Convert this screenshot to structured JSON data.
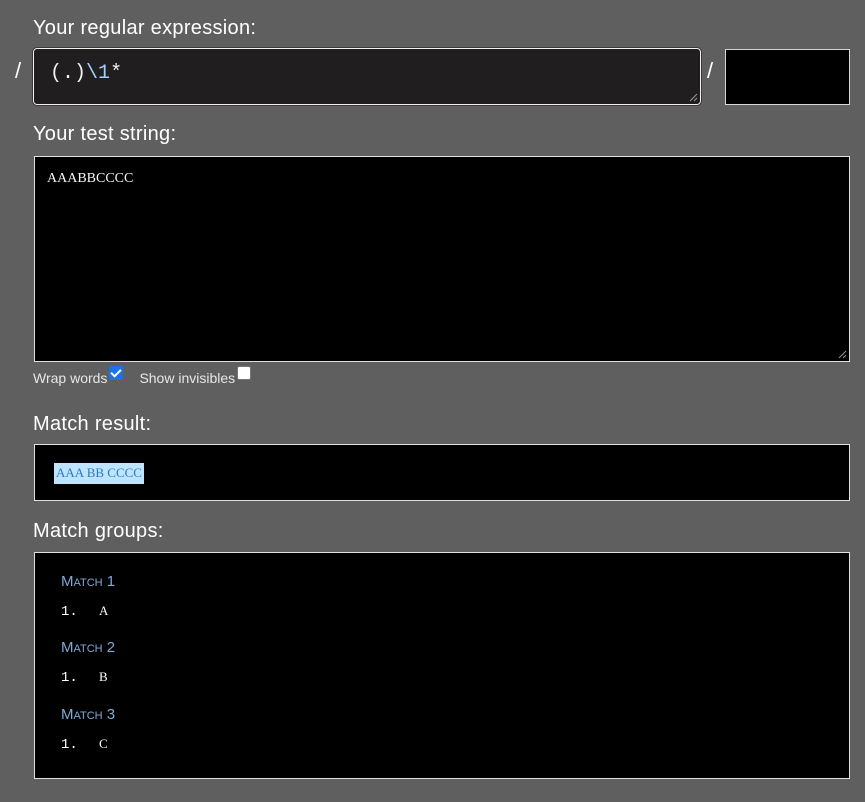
{
  "regex": {
    "label": "Your regular expression:",
    "slash_open": "/",
    "slash_close": "/",
    "pattern_paren_open": "(",
    "pattern_dot": ".",
    "pattern_paren_close": ")",
    "pattern_backref": "\\1",
    "pattern_quant": "*",
    "flags": ""
  },
  "test": {
    "label": "Your test string:",
    "value": "AAABBCCCC"
  },
  "options": {
    "wrap_label": "Wrap words",
    "wrap_checked": true,
    "invisibles_label": "Show invisibles",
    "invisibles_checked": false
  },
  "result": {
    "label": "Match result:",
    "value": "AAA BB CCCC"
  },
  "groups": {
    "label": "Match groups:",
    "matches": [
      {
        "title": "Match 1",
        "index": "1.",
        "value": "A"
      },
      {
        "title": "Match 2",
        "index": "1.",
        "value": "B"
      },
      {
        "title": "Match 3",
        "index": "1.",
        "value": "C"
      }
    ]
  },
  "colors": {
    "background": "#5f5f5f",
    "highlight": "#bfe4ff",
    "match_title": "#7fa9d8",
    "checkbox": "#1a73e8"
  }
}
